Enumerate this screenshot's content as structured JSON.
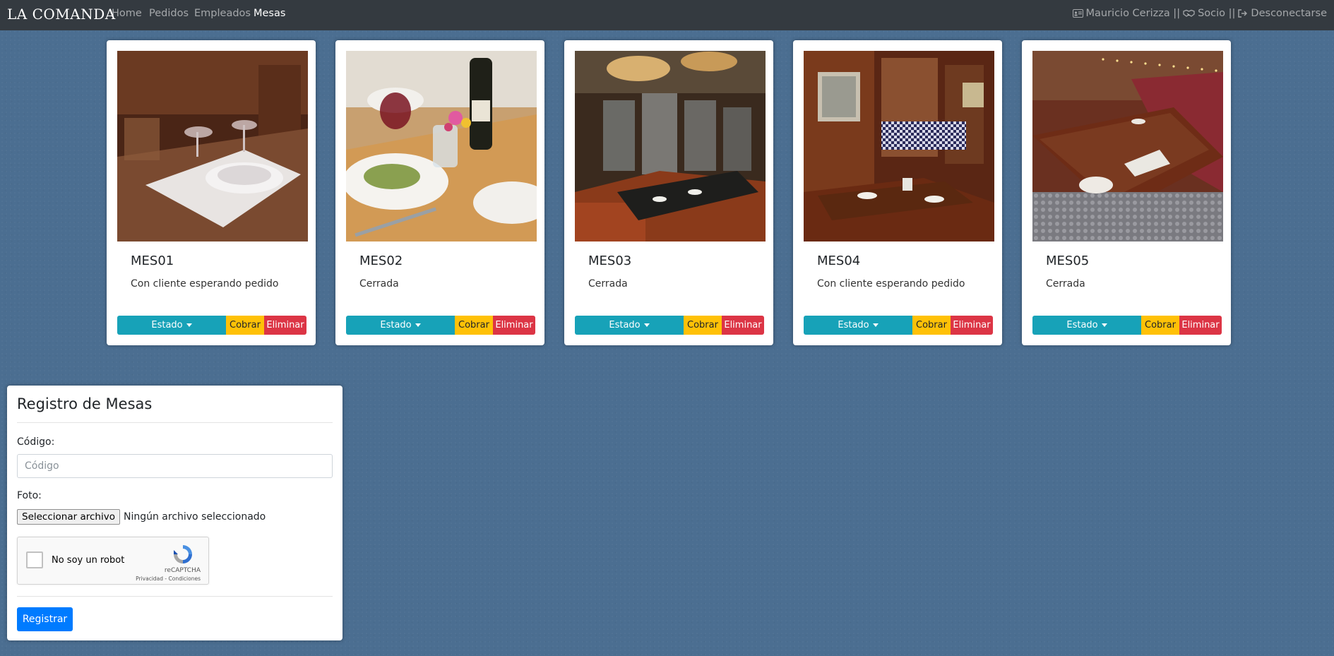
{
  "nav": {
    "brand": "LA COMANDA",
    "links": [
      "Home",
      "Pedidos",
      "Empleados",
      "Mesas"
    ],
    "user": "Mauricio Cerizza ||",
    "role": "Socio ||",
    "logout": "Desconectarse"
  },
  "cards": [
    {
      "code": "MES01",
      "status": "Con cliente esperando pedido",
      "estado": "Estado",
      "cobrar": "Cobrar",
      "eliminar": "Eliminar"
    },
    {
      "code": "MES02",
      "status": "Cerrada",
      "estado": "Estado",
      "cobrar": "Cobrar",
      "eliminar": "Eliminar"
    },
    {
      "code": "MES03",
      "status": "Cerrada",
      "estado": "Estado",
      "cobrar": "Cobrar",
      "eliminar": "Eliminar"
    },
    {
      "code": "MES04",
      "status": "Con cliente esperando pedido",
      "estado": "Estado",
      "cobrar": "Cobrar",
      "eliminar": "Eliminar"
    },
    {
      "code": "MES05",
      "status": "Cerrada",
      "estado": "Estado",
      "cobrar": "Cobrar",
      "eliminar": "Eliminar"
    }
  ],
  "form": {
    "title": "Registro de Mesas",
    "code_label": "Código:",
    "code_placeholder": "Código",
    "photo_label": "Foto:",
    "file_button": "Seleccionar archivo",
    "file_status": "Ningún archivo seleccionado",
    "captcha_label": "No soy un robot",
    "captcha_brand": "reCAPTCHA",
    "captcha_links": "Privacidad - Condiciones",
    "submit": "Registrar"
  },
  "colors": {
    "background": "#4b6e91",
    "navbar": "#343a40",
    "info": "#17a2b8",
    "warning": "#ffc107",
    "danger": "#dc3545",
    "primary": "#007bff"
  }
}
